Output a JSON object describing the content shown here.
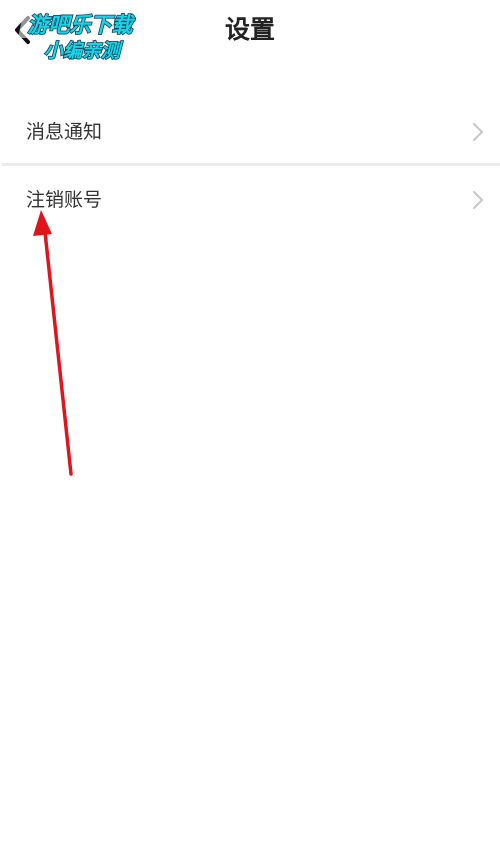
{
  "header": {
    "title": "设置",
    "back_icon": "chevron-left-icon"
  },
  "watermark": {
    "line1": "游吧乐下载",
    "line2": "小编亲测"
  },
  "settings": {
    "items": [
      {
        "label": "消息通知",
        "icon": "chevron-right-icon"
      },
      {
        "label": "注销账号",
        "icon": "chevron-right-icon"
      }
    ]
  },
  "annotation": {
    "color": "#e0141b",
    "points_to": "注销账号"
  },
  "colors": {
    "watermark_cyan": "#19d3e6",
    "chevron": "#c7c7c7",
    "divider": "#ececec"
  }
}
